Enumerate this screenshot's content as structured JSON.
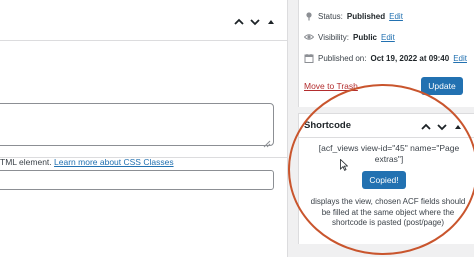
{
  "publish": {
    "status_label": "Status:",
    "status_value": "Published",
    "status_edit": "Edit",
    "visibility_label": "Visibility:",
    "visibility_value": "Public",
    "visibility_edit": "Edit",
    "published_label": "Published on:",
    "published_value": "Oct 19, 2022 at 09:40",
    "published_edit": "Edit",
    "trash_label": "Move to Trash",
    "update_label": "Update"
  },
  "shortcode": {
    "title": "Shortcode",
    "code": "[acf_views view-id=\"45\" name=\"Page extras\"]",
    "copied_label": "Copied!",
    "description": "displays the view, chosen ACF fields should be filled at the same object where the shortcode is pasted (post/page)"
  },
  "left": {
    "help_text": "TML element.",
    "help_link": "Learn more about CSS Classes"
  },
  "colors": {
    "accent": "#2271b1",
    "trash": "#b32d2e",
    "ring": "#c9552d"
  }
}
